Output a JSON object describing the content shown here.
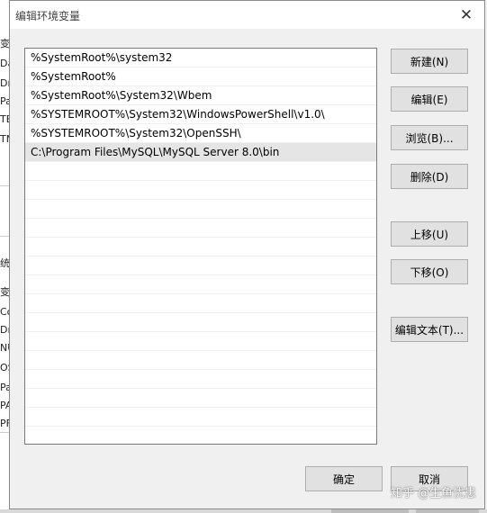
{
  "background": {
    "fragments": [
      "变",
      "Da",
      "Dr",
      "Pa",
      "TE",
      "TM",
      "统",
      "变",
      "Co",
      "Dr",
      "NU",
      "OS",
      "Pa",
      "PA",
      "PF"
    ]
  },
  "dialog": {
    "title": "编辑环境变量",
    "close_symbol": "✕",
    "path_entries": [
      "%SystemRoot%\\system32",
      "%SystemRoot%",
      "%SystemRoot%\\System32\\Wbem",
      "%SYSTEMROOT%\\System32\\WindowsPowerShell\\v1.0\\",
      "%SYSTEMROOT%\\System32\\OpenSSH\\",
      "C:\\Program Files\\MySQL\\MySQL Server 8.0\\bin",
      "",
      "",
      "",
      "",
      "",
      "",
      "",
      "",
      "",
      "",
      "",
      "",
      "",
      "",
      ""
    ],
    "selected_index": 5,
    "buttons": {
      "new": "新建(N)",
      "edit": "编辑(E)",
      "browse": "浏览(B)...",
      "delete": "删除(D)",
      "move_up": "上移(U)",
      "move_down": "下移(O)",
      "edit_text": "编辑文本(T)...",
      "ok": "确定",
      "cancel": "取消"
    }
  },
  "watermark": "知乎 @生鱼忧患",
  "colors": {
    "selection": "#e5e5e5",
    "button_face": "#e1e1e1",
    "button_border": "#adadad",
    "dialog_bg": "#f0f0f0"
  }
}
